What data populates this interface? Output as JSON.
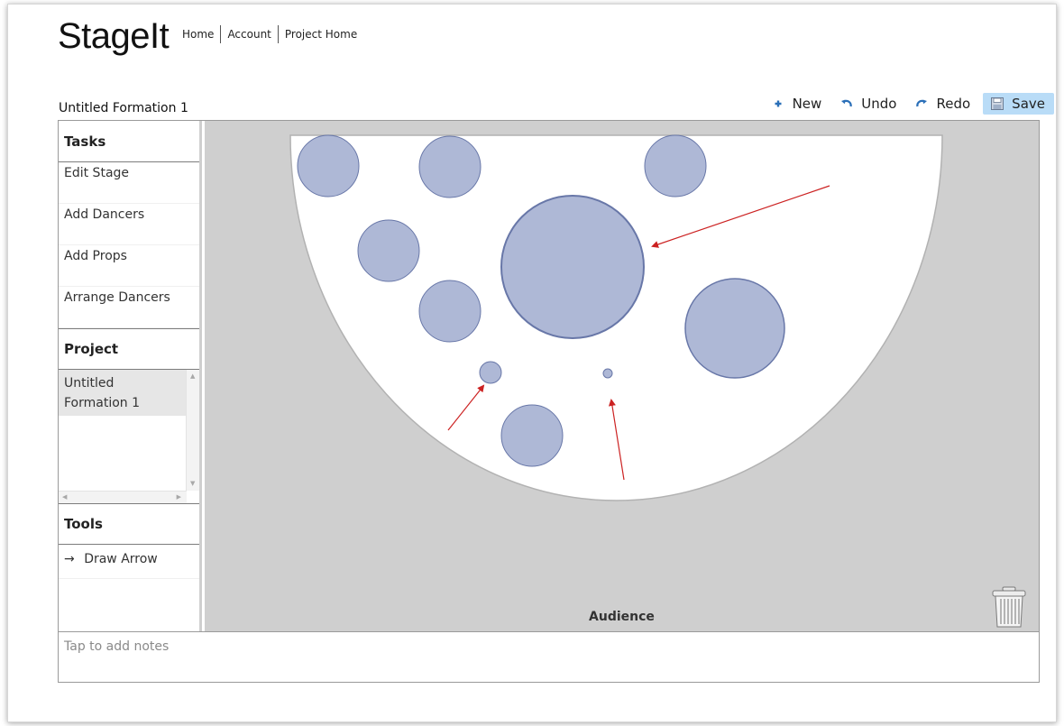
{
  "app": {
    "title": "StageIt"
  },
  "nav": {
    "items": [
      "Home",
      "Account",
      "Project Home"
    ]
  },
  "formation": {
    "title": "Untitled Formation 1"
  },
  "toolbar": {
    "new_label": "New",
    "undo_label": "Undo",
    "redo_label": "Redo",
    "save_label": "Save"
  },
  "sidebar": {
    "tasks_header": "Tasks",
    "tasks": [
      "Edit Stage",
      "Add Dancers",
      "Add Props",
      "Arrange Dancers"
    ],
    "project_header": "Project",
    "project_items": [
      "Untitled",
      "Formation 1"
    ],
    "tools_header": "Tools",
    "tools": [
      {
        "label": "Draw Arrow",
        "icon": "arrow-right-icon"
      }
    ]
  },
  "stage": {
    "audience_label": "Audience",
    "dancer_color": "#aeb8d6",
    "dancer_stroke": "#6877a8",
    "arrow_color": "#cc2222"
  },
  "notes": {
    "placeholder": "Tap to add notes"
  },
  "colors": {
    "save_bg": "#b9dcf7",
    "stage_bg": "#cfcfcf",
    "icon_blue": "#2a6fb8"
  }
}
